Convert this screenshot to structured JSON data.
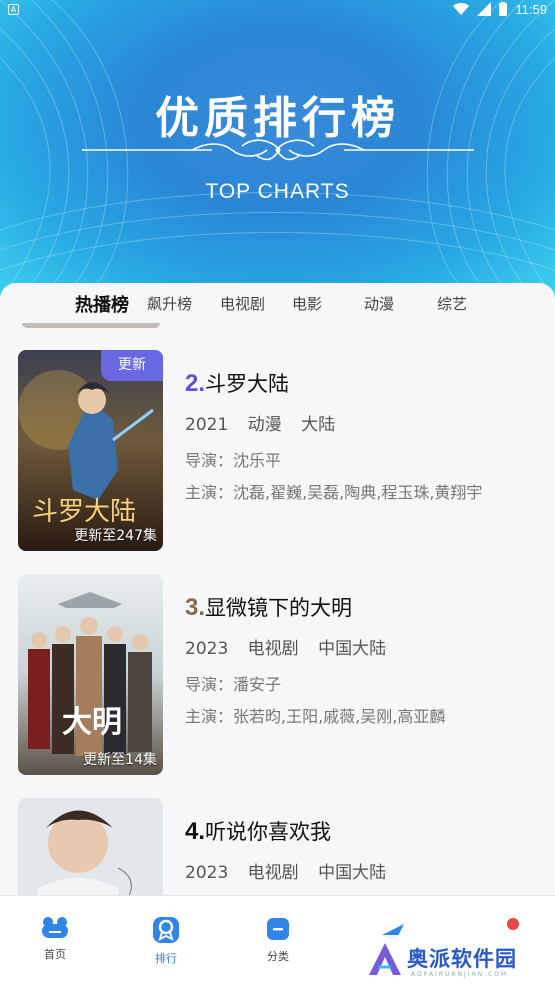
{
  "status_bar": {
    "app_badge": "A",
    "time": "11:59"
  },
  "hero": {
    "title": "优质排行榜",
    "subtitle": "TOP CHARTS"
  },
  "tabs": [
    "热播榜",
    "飙升榜",
    "电视剧",
    "电影",
    "动漫",
    "综艺"
  ],
  "items": [
    {
      "rank": "2.",
      "rank_color": "#5a55d8",
      "name": "斗罗大陆",
      "year": "2021",
      "type": "动漫",
      "region": "大陆",
      "director": "导演：沈乐平",
      "cast": "主演：沈磊,翟巍,吴磊,陶典,程玉珠,黄翔宇",
      "badge": "更新",
      "episodes": "更新至247集",
      "poster_text": "斗罗大陆"
    },
    {
      "rank": "3.",
      "rank_color": "#8a6a48",
      "name": "显微镜下的大明",
      "year": "2023",
      "type": "电视剧",
      "region": "中国大陆",
      "director": "导演：潘安子",
      "cast": "主演：张若昀,王阳,戚薇,吴刚,高亚麟",
      "episodes": "更新至14集",
      "poster_text": "大明"
    },
    {
      "rank": "4.",
      "rank_color": "#111111",
      "name": "听说你喜欢我",
      "year": "2023",
      "type": "电视剧",
      "region": "中国大陆"
    }
  ],
  "nav": [
    {
      "label": "首页",
      "icon": "home-icon"
    },
    {
      "label": "排行",
      "icon": "ranking-icon"
    },
    {
      "label": "分类",
      "icon": "category-icon"
    }
  ],
  "watermark": {
    "text": "奥派软件园",
    "url": "AOPAIRUANJIAN.COM"
  }
}
